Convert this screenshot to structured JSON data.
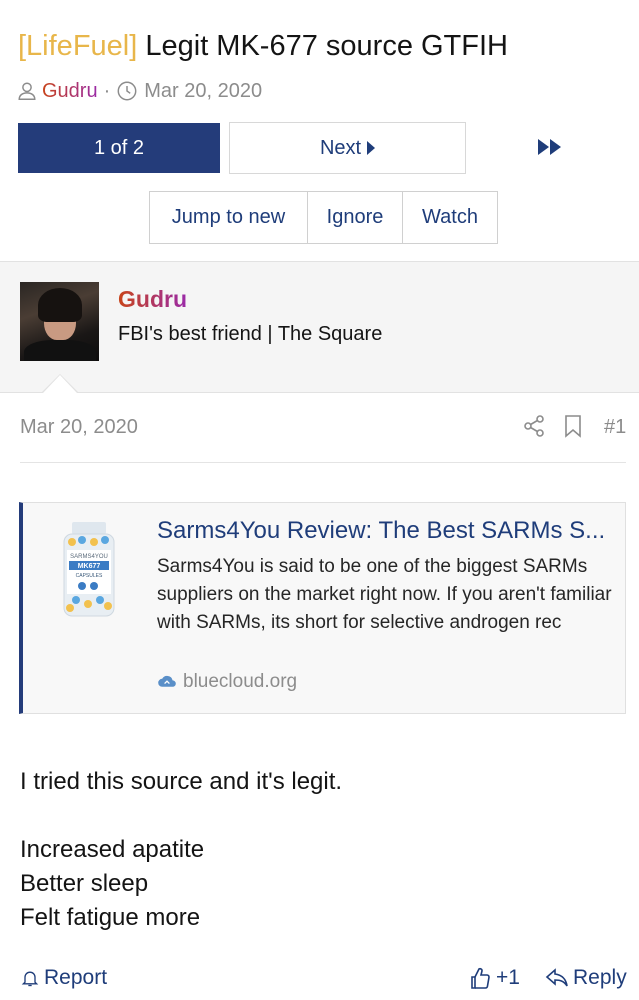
{
  "thread": {
    "prefix": "[LifeFuel]",
    "title": "Legit MK-677 source GTFIH",
    "author": "Gudru",
    "separator": "·",
    "date": "Mar 20, 2020"
  },
  "pagination": {
    "current": "1 of 2",
    "next_label": "Next"
  },
  "actions": {
    "jump_to_new": "Jump to new",
    "ignore": "Ignore",
    "watch": "Watch"
  },
  "post": {
    "username": "Gudru",
    "user_title": "FBI's best friend | The Square",
    "date": "Mar 20, 2020",
    "number": "#1",
    "body_lines": [
      "I tried this source and it's legit.",
      "Increased apatite",
      "Better sleep",
      "Felt fatigue more"
    ],
    "report_label": "Report",
    "like_label": "+1",
    "reply_label": "Reply"
  },
  "unfurl": {
    "title": "Sarms4You Review: The Best SARMs S...",
    "description": "Sarms4You is said to be one of the biggest SARMs suppliers on the market right now. If you aren't familiar with SARMs, its short for selective androgen rec",
    "domain": "bluecloud.org",
    "image_brand": "SARMS4YOU",
    "image_label": "MK677",
    "image_sublabel": "CAPSULES"
  },
  "colors": {
    "accent": "#243c7a",
    "link": "#1f3d7a",
    "prefix": "#e8b64a",
    "muted": "#8c8c8c"
  }
}
